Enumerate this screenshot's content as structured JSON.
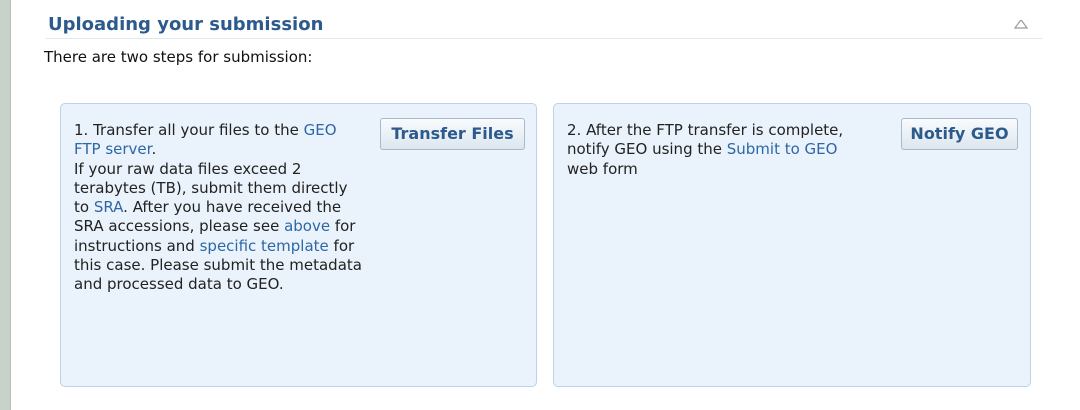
{
  "section": {
    "title": "Uploading your submission",
    "collapse_icon": "chevron-up-icon"
  },
  "intro": "There are two steps for submission:",
  "step1": {
    "button_label": "Transfer Files",
    "t1": "1. Transfer all your files to the ",
    "link_ftp": "GEO FTP server",
    "t2": ".",
    "t3": "If your raw data files exceed 2 terabytes (TB), submit them directly to ",
    "link_sra": "SRA",
    "t4": ". After you have received the SRA accessions, please see ",
    "link_above": "above",
    "t5": " for instructions and ",
    "link_template": "specific template",
    "t6": " for this case. Please submit the metadata and processed data to GEO."
  },
  "step2": {
    "button_label": "Notify GEO",
    "t1": "2. After the FTP transfer is complete, notify GEO using the ",
    "link_submit": "Submit to GEO",
    "t2": " web form"
  },
  "colors": {
    "title": "#2c5a8c",
    "link": "#2d67a6",
    "box_bg": "#eaf3fb",
    "box_border": "#bcd3e6"
  }
}
